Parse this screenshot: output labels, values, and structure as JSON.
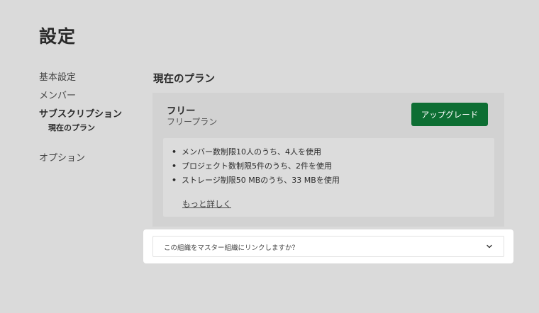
{
  "page": {
    "title": "設定"
  },
  "sidebar": {
    "items": [
      {
        "label": "基本設定"
      },
      {
        "label": "メンバー"
      },
      {
        "label": "サブスクリプション"
      },
      {
        "label": "オプション"
      }
    ],
    "subitems": [
      {
        "label": "現在のプラン"
      }
    ]
  },
  "main": {
    "section_title": "現在のプラン",
    "plan": {
      "name": "フリー",
      "subname": "フリープラン",
      "upgrade_label": "アップグレード",
      "upgrade_color": "#0d6e33",
      "usage": [
        {
          "text": "メンバー数制限10人のうち、4人を使用"
        },
        {
          "text": "プロジェクト数制限5件のうち、2件を使用"
        },
        {
          "text": "ストレージ制限50 MBのうち、33 MBを使用"
        }
      ],
      "more_link": "もっと詳しく"
    },
    "link_panel": {
      "question": "この組織をマスター組織にリンクしますか？",
      "icon": "chevron-down-icon"
    }
  }
}
